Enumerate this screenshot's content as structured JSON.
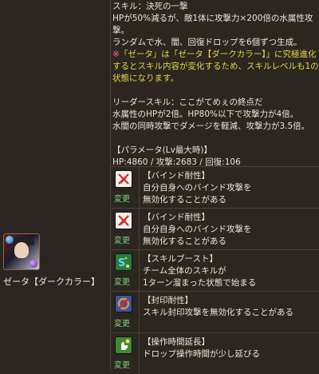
{
  "character": {
    "name": "ゼータ【ダークカラー】"
  },
  "skill": {
    "lines": [
      {
        "text": "スキル：決死の一撃",
        "color": "normal"
      },
      {
        "text": "HPが50%減るが、敵1体に攻撃力×200倍の水属性攻",
        "color": "normal"
      },
      {
        "text": "撃。",
        "color": "normal"
      },
      {
        "text": "ランダムで水、闇、回復ドロップを6個ずつ生成。",
        "color": "normal"
      }
    ],
    "note_mark": "※",
    "note_lines": [
      "「ゼータ」は「ゼータ【ダークカラー】」に究極進化",
      "するとスキル内容が変化するため、スキルレベルも1の",
      "状態になります。"
    ],
    "leader_lines": [
      "リーダースキル：ここがてめぇの終点だ",
      "水属性のHPが2倍。HP80%以下で攻撃力が4倍。",
      "水闇の同時攻撃でダメージを軽減、攻撃力が3.5倍。"
    ],
    "params_title": "【パラメータ(Lv最大時)】",
    "params_values": "HP:4860 / 攻撃:2683 / 回復:106"
  },
  "awakenings": [
    {
      "icon": "bind-resist-icon",
      "change": "変更",
      "title": "【バインド耐性】",
      "desc": [
        "自分自身へのバインド攻撃を",
        "無効化することがある"
      ]
    },
    {
      "icon": "bind-resist-icon",
      "change": "変更",
      "title": "【バインド耐性】",
      "desc": [
        "自分自身へのバインド攻撃を",
        "無効化することがある"
      ]
    },
    {
      "icon": "skill-boost-icon",
      "change": "変更",
      "title": "【スキルブースト】",
      "desc": [
        "チーム全体のスキルが",
        "1ターン溜まった状態で始まる"
      ]
    },
    {
      "icon": "skill-seal-resist-icon",
      "change": "変更",
      "title": "【封印耐性】",
      "desc": [
        "スキル封印攻撃を無効化することがある"
      ]
    },
    {
      "icon": "time-extend-icon",
      "change": "変更",
      "title": "【操作時間延長】",
      "desc": [
        "ドロップ操作時間が少し延びる"
      ]
    }
  ]
}
